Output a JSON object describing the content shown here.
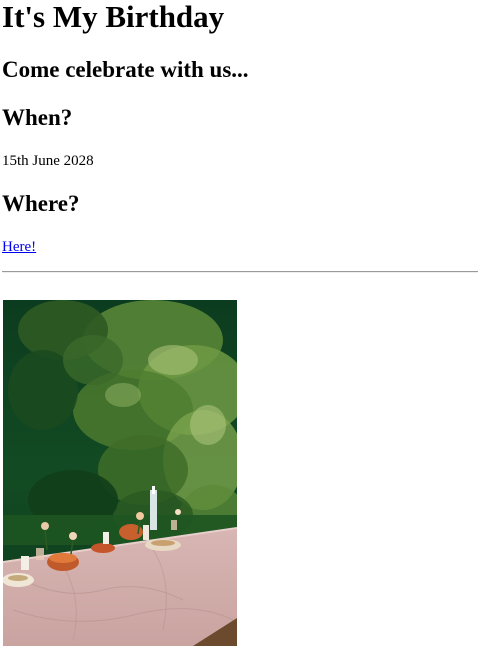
{
  "heading": "It's My Birthday",
  "subheading": "Come celebrate with us...",
  "when": {
    "heading": "When?",
    "date": "15th June 2028"
  },
  "where": {
    "heading": "Where?",
    "link_text": "Here!"
  },
  "photo": {
    "alt": "outdoor dinner table with pink tablecloth set under green trees"
  },
  "colors": {
    "link": "#0000ee",
    "rule": "#9a9a9a"
  }
}
